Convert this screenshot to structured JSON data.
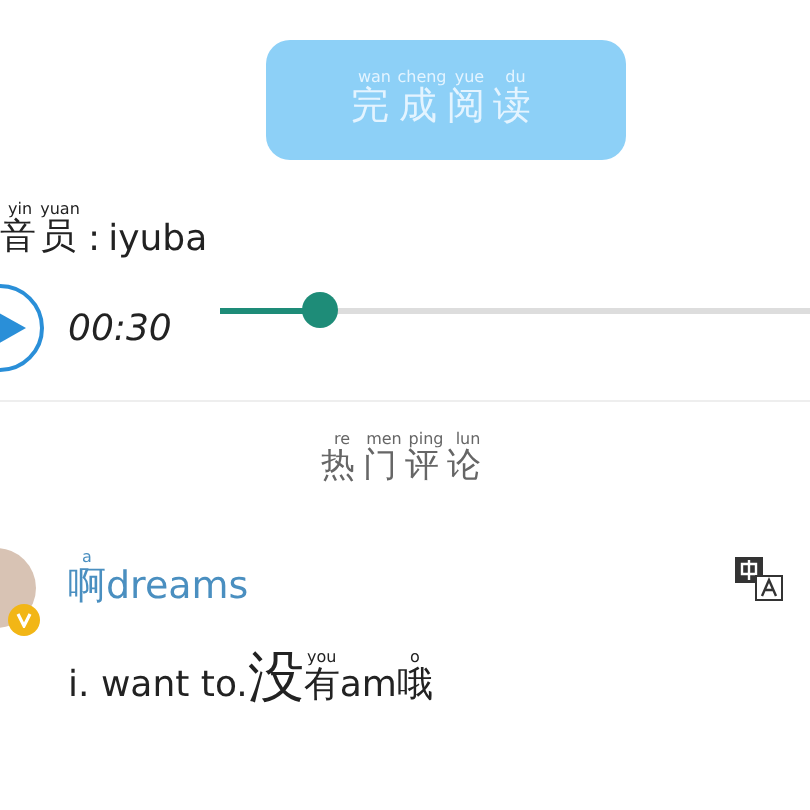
{
  "finish_button": {
    "label": [
      {
        "char": "完",
        "pinyin": "wan"
      },
      {
        "char": "成",
        "pinyin": "cheng"
      },
      {
        "char": "阅",
        "pinyin": "yue"
      },
      {
        "char": "读",
        "pinyin": "du"
      }
    ]
  },
  "announcer": {
    "label": [
      {
        "char": "音",
        "pinyin": "yin"
      },
      {
        "char": "员",
        "pinyin": "yuan"
      }
    ],
    "separator": ":",
    "name": "iyuba"
  },
  "player": {
    "time": "00:30",
    "level": 0.17
  },
  "section_title": [
    {
      "char": "热",
      "pinyin": "re"
    },
    {
      "char": "门",
      "pinyin": "men"
    },
    {
      "char": "评",
      "pinyin": "ping"
    },
    {
      "char": "论",
      "pinyin": "lun"
    }
  ],
  "comments": [
    {
      "user": [
        {
          "char": "啊",
          "pinyin": "a"
        },
        {
          "char": "dreams"
        }
      ],
      "verified": true,
      "text": [
        {
          "char": "i. want to."
        },
        {
          "char": "没",
          "big": true
        },
        {
          "char": "有",
          "pinyin": "you"
        },
        {
          "char": "am"
        },
        {
          "char": "哦",
          "pinyin": "o"
        }
      ]
    }
  ]
}
